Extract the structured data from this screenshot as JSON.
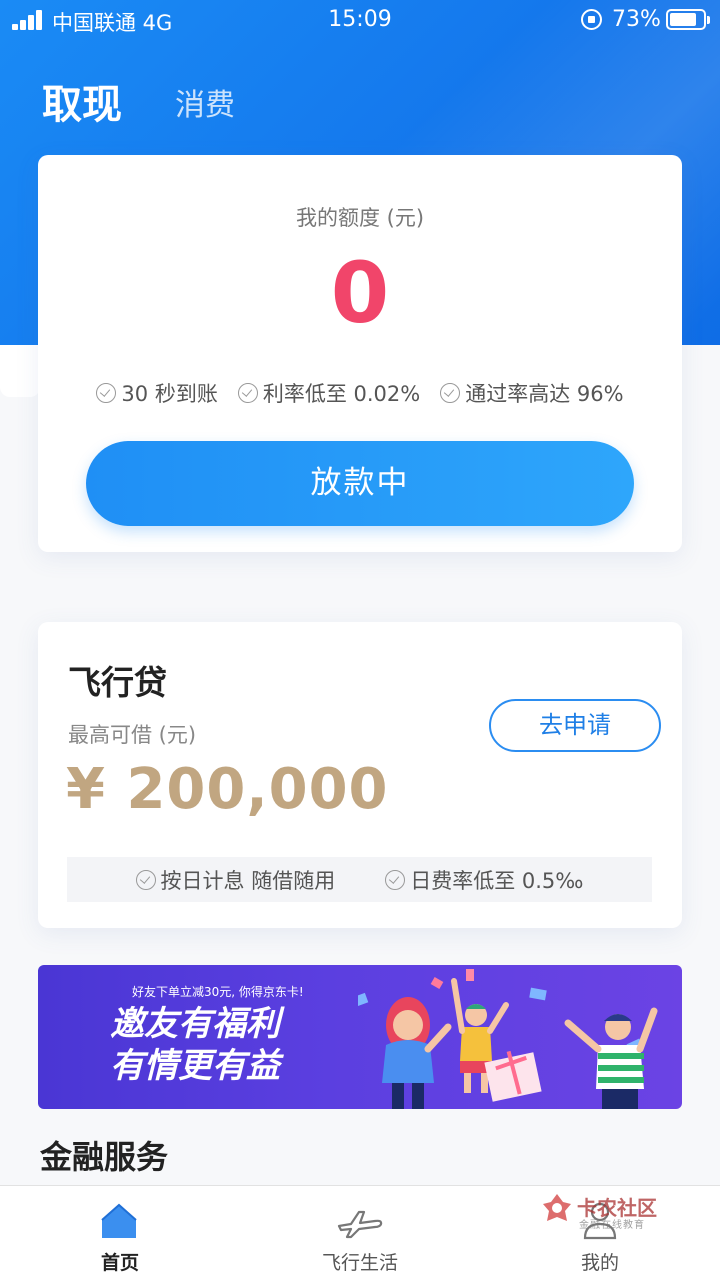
{
  "status_bar": {
    "carrier": "中国联通  4G",
    "time": "15:09",
    "battery": "73%",
    "battery_level": 0.73,
    "icons": [
      "signal-icon",
      "rotation-lock-icon",
      "battery-icon"
    ]
  },
  "header": {
    "active_tab": "取现",
    "inactive_tab": "消费"
  },
  "quota_card": {
    "label": "我的额度 (元)",
    "value": "0",
    "features": [
      "30 秒到账",
      "利率低至 0.02%",
      "通过率高达 96%"
    ],
    "button": "放款中"
  },
  "loan_card": {
    "title": "飞行贷",
    "subtitle": "最高可借 (元)",
    "amount": "¥ 200,000",
    "apply_button": "去申请",
    "features": [
      "按日计息 随借随用",
      "日费率低至 0.5‰"
    ]
  },
  "banner": {
    "small_text": "好友下单立减30元, 你得京东卡!",
    "title_line1": "邀友有福利",
    "title_line2": "有情更有益"
  },
  "section": {
    "title": "金融服务"
  },
  "tab_bar": {
    "items": [
      {
        "label": "首页",
        "icon": "home-icon",
        "active": true
      },
      {
        "label": "飞行生活",
        "icon": "airplane-icon",
        "active": false
      },
      {
        "label": "我的",
        "icon": "user-icon",
        "active": false
      }
    ]
  },
  "watermark": {
    "title": "卡农社区",
    "subtitle": "金融在线教育"
  },
  "colors": {
    "primary": "#1a8bf5",
    "quota_red": "#f1456a",
    "gold": "#c1a681",
    "banner_purple": "#5b3fe0"
  }
}
